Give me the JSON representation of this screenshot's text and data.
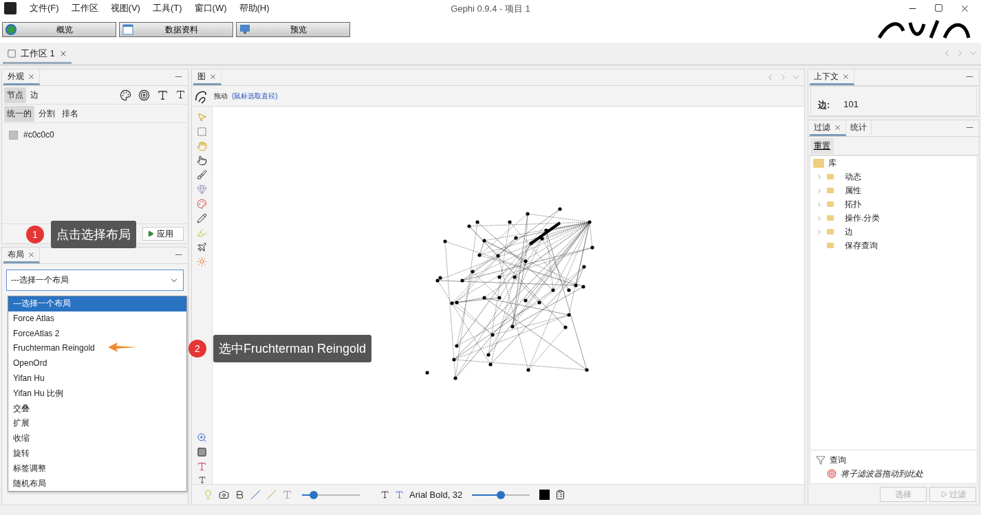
{
  "title_bar": {
    "title": "Gephi 0.9.4 - 项目 1",
    "menus": [
      "文件(F)",
      "工作区",
      "视图(V)",
      "工具(T)",
      "窗口(W)",
      "帮助(H)"
    ]
  },
  "mode_buttons": [
    {
      "label": "概览",
      "kind": "globe"
    },
    {
      "label": "数据资料",
      "kind": "table"
    },
    {
      "label": "预览",
      "kind": "monitor"
    }
  ],
  "workspace_tab": {
    "label": "工作区 1"
  },
  "appearance_panel": {
    "title": "外观",
    "element_tabs": [
      {
        "label": "节点",
        "selected": true
      },
      {
        "label": "边",
        "selected": false
      }
    ],
    "mode_tabs": [
      {
        "label": "统一的",
        "selected": true
      },
      {
        "label": "分割",
        "selected": false
      },
      {
        "label": "排名",
        "selected": false
      }
    ],
    "color_value": "#c0c0c0",
    "apply_button": "应用"
  },
  "layout_panel": {
    "title": "布局",
    "select": {
      "value": "---选择一个布局",
      "expanded": true
    },
    "options": [
      {
        "label": "---选择一个布局",
        "selected": true
      },
      {
        "label": "Force Atlas",
        "selected": false
      },
      {
        "label": "ForceAtlas 2",
        "selected": false
      },
      {
        "label": "Fruchterman Reingold",
        "selected": false
      },
      {
        "label": "OpenOrd",
        "selected": false
      },
      {
        "label": "Yifan Hu",
        "selected": false
      },
      {
        "label": "Yifan Hu 比例",
        "selected": false
      },
      {
        "label": "交叠",
        "selected": false
      },
      {
        "label": "扩展",
        "selected": false
      },
      {
        "label": "收缩",
        "selected": false
      },
      {
        "label": "旋转",
        "selected": false
      },
      {
        "label": "标签调整",
        "selected": false
      },
      {
        "label": "随机布局",
        "selected": false
      }
    ]
  },
  "graph_panel": {
    "title": "图",
    "tool_label": "拖动",
    "tool_hint": "(鼠标选取直径)",
    "edge_slider": {
      "level": 0.2
    },
    "font_label": "Arial Bold, 32",
    "size_slider": {
      "level": 0.5
    }
  },
  "context_panel": {
    "title": "上下文",
    "edges_label": "边:",
    "edges_value": "101"
  },
  "filter_panel": {
    "tabs": [
      {
        "label": "过滤",
        "selected": true
      },
      {
        "label": "统计",
        "selected": false
      }
    ],
    "reset_button": "重置",
    "library": {
      "label": "库",
      "children": [
        {
          "label": "动态",
          "has_children": true
        },
        {
          "label": "属性",
          "has_children": true
        },
        {
          "label": "拓扑",
          "has_children": true
        },
        {
          "label": "操作.分类",
          "has_children": true
        },
        {
          "label": "边",
          "has_children": true
        },
        {
          "label": "保存查询",
          "has_children": false
        }
      ]
    },
    "query_label": "查询",
    "query_hint": "将子滤波器拖动到此处",
    "select_button": {
      "label": "选择",
      "disabled": true
    },
    "filter_button": {
      "label": "过滤",
      "disabled": true
    }
  },
  "annotations": [
    {
      "number": "1",
      "text": "点击选择布局"
    },
    {
      "number": "2",
      "text": "选中Fruchterman Reingold"
    }
  ]
}
